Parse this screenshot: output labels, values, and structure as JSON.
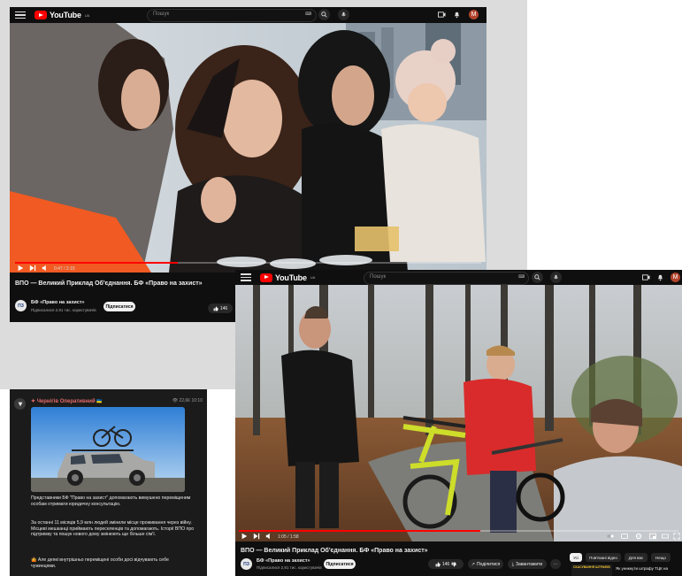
{
  "youtube_top": {
    "logo_text": "YouTube",
    "country_code": "UA",
    "search_placeholder": "Пошук",
    "avatar_letter": "M",
    "video_time": "0:47 / 2:15",
    "progress": 0.35,
    "video_title": "ВПО — Великий Приклад Об'єднання. БФ «Право на захист»",
    "channel_name": "БФ «Право на захист»",
    "channel_subs": "Підписалися 2,91 тис. користувачів",
    "subscribe_label": "Підписатися",
    "like_count": "146"
  },
  "youtube_main": {
    "logo_text": "YouTube",
    "country_code": "UA",
    "search_placeholder": "Пошук",
    "avatar_letter": "M",
    "video_time": "1:05 / 1:58",
    "progress": 0.55,
    "video_title": "ВПО — Великий Приклад Об'єднання. БФ «Право на захист»",
    "channel_name": "БФ «Право на захист»",
    "channel_subs": "Підписалися 2,91 тис. користувачів",
    "subscribe_label": "Підписатися",
    "like_count": "146",
    "share_label": "Поділитися",
    "download_label": "Завантажити",
    "chips": [
      "Усі",
      "Пов'язані відео",
      "Для вас",
      "Нещо"
    ],
    "side_promo": "СКАСУВАННЯ ШТРАФІВ",
    "side_promo_caption": "Як уникнути штрафу ТЦК на"
  },
  "telegram": {
    "channel_name": "Чернігів Оперативний",
    "views": "22,6К 10:10",
    "paragraph_1": "Представники БФ \"Право на захист\" допомагають вимушено переміщеним особам отримати юридичну консультацію.",
    "paragraph_2": "За останні 11 місяців 5,9 млн людей змінили місце проживання через війну. Місцеві мешканці приймають переселенців та допомагають. Історії ВПО про підтримку та пошук нового дому змінюють ще більше сім'ї.",
    "paragraph_3": "Але деякі внутрішньо переміщені особи досі відчувають себе чужинцями."
  },
  "colors": {
    "yt_red": "#ff0000",
    "yt_bg": "#0f0f0f",
    "tg_bg": "#1b1b1b",
    "tg_channel_red": "#e56a6a"
  }
}
